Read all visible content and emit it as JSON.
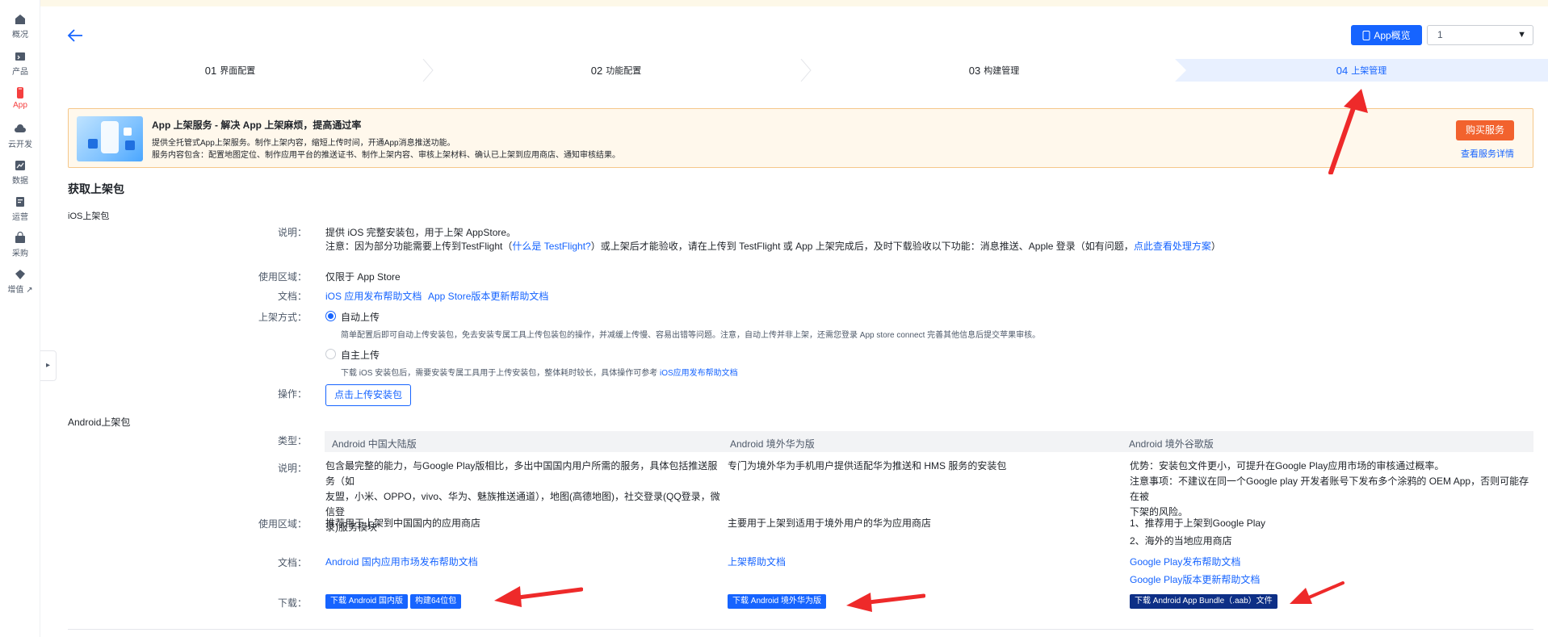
{
  "rail": [
    {
      "label": "概况",
      "icon": "home-icon"
    },
    {
      "label": "产品",
      "icon": "product-icon"
    },
    {
      "label": "App",
      "icon": "app-icon"
    },
    {
      "label": "云开发",
      "icon": "cloud-icon"
    },
    {
      "label": "数据",
      "icon": "chart-icon"
    },
    {
      "label": "运营",
      "icon": "operation-icon"
    },
    {
      "label": "采购",
      "icon": "purchase-icon"
    },
    {
      "label": "增值",
      "icon": "value-added-icon"
    }
  ],
  "header": {
    "overview_label": "App概览",
    "select_value": "1"
  },
  "steps": [
    {
      "num": "01",
      "label": "界面配置"
    },
    {
      "num": "02",
      "label": "功能配置"
    },
    {
      "num": "03",
      "label": "构建管理"
    },
    {
      "num": "04",
      "label": "上架管理"
    }
  ],
  "banner": {
    "title": "App 上架服务 - 解决 App 上架麻烦，提高通过率",
    "line1": "提供全托管式App上架服务。制作上架内容，缩短上传时间，开通App消息推送功能。",
    "line2": "服务内容包含：配置地图定位、制作应用平台的推送证书、制作上架内容、审核上架材料、确认已上架到应用商店、通知审核结果。",
    "buy_label": "购买服务",
    "detail_label": "查看服务详情"
  },
  "section": {
    "title": "获取上架包",
    "ios_title": "iOS上架包",
    "android_title": "Android上架包"
  },
  "ios": {
    "desc_label": "说明：",
    "desc_line1": "提供 iOS 完整安装包，用于上架 AppStore。",
    "desc_note_a": "注意：因为部分功能需要上传到TestFlight（",
    "desc_note_link1": "什么是 TestFlight?",
    "desc_note_b": "）或上架后才能验收，请在上传到 TestFlight 或 App 上架完成后，及时下载验收以下功能：消息推送、Apple 登录（如有问题，",
    "desc_note_link2": "点此查看处理方案",
    "desc_note_c": "）",
    "region_label": "使用区域：",
    "region_value": "仅限于 App Store",
    "doc_label": "文档：",
    "doc_link1": "iOS 应用发布帮助文档",
    "doc_link2": "App Store版本更新帮助文档",
    "method_label": "上架方式：",
    "auto_label": "自动上传",
    "auto_desc": "简单配置后即可自动上传安装包，免去安装专属工具上传包装包的操作，并减缓上传慢、容易出错等问题。注意，自动上传并非上架，还需您登录 App store connect 完善其他信息后提交苹果审核。",
    "manual_label": "自主上传",
    "manual_desc": "下载 iOS 安装包后，需要安装专属工具用于上传安装包，整体耗时较长，具体操作可参考",
    "manual_link": "iOS应用发布帮助文档",
    "action_label": "操作：",
    "upload_button": "点击上传安装包"
  },
  "android": {
    "type_label": "类型：",
    "desc_label": "说明：",
    "region_label": "使用区域：",
    "doc_label": "文档：",
    "download_label": "下载：",
    "cols": [
      {
        "title": "Android 中国大陆版",
        "desc": [
          "包含最完整的能力，与Google Play版相比，多出中国国内用户所需的服务，具体包括推送服务（如",
          "友盟，小米、OPPO，vivo、华为、魅族推送通道），地图(高德地图)，社交登录(QQ登录，微信登",
          "录)服务模块"
        ],
        "region": [
          "推荐用于上架到中国国内的应用商店"
        ],
        "docs": [
          "Android 国内应用市场发布帮助文档"
        ],
        "buttons": [
          "下载 Android 国内版",
          "构建64位包"
        ]
      },
      {
        "title": "Android 境外华为版",
        "desc": [
          "专门为境外华为手机用户提供适配华为推送和 HMS 服务的安装包"
        ],
        "region": [
          "主要用于上架到适用于境外用户的华为应用商店"
        ],
        "docs": [
          "上架帮助文档"
        ],
        "buttons": [
          "下载 Android 境外华为版"
        ]
      },
      {
        "title": "Android 境外谷歌版",
        "desc": [
          "优势：安装包文件更小，可提升在Google Play应用市场的审核通过概率。",
          "注意事项：不建议在同一个Google play 开发者账号下发布多个涂鸦的 OEM App，否则可能存在被",
          "下架的风险。"
        ],
        "region": [
          "1、推荐用于上架到Google Play",
          "2、海外的当地应用商店"
        ],
        "docs": [
          "Google Play发布帮助文档",
          "Google Play版本更新帮助文档"
        ],
        "buttons": [
          "下载 Android App Bundle（.aab）文件"
        ]
      }
    ]
  },
  "colors": {
    "accent": "#1664ff",
    "rail_active": "#f53f3f",
    "buy": "#f2622e",
    "arrow": "#ee2a2a"
  }
}
